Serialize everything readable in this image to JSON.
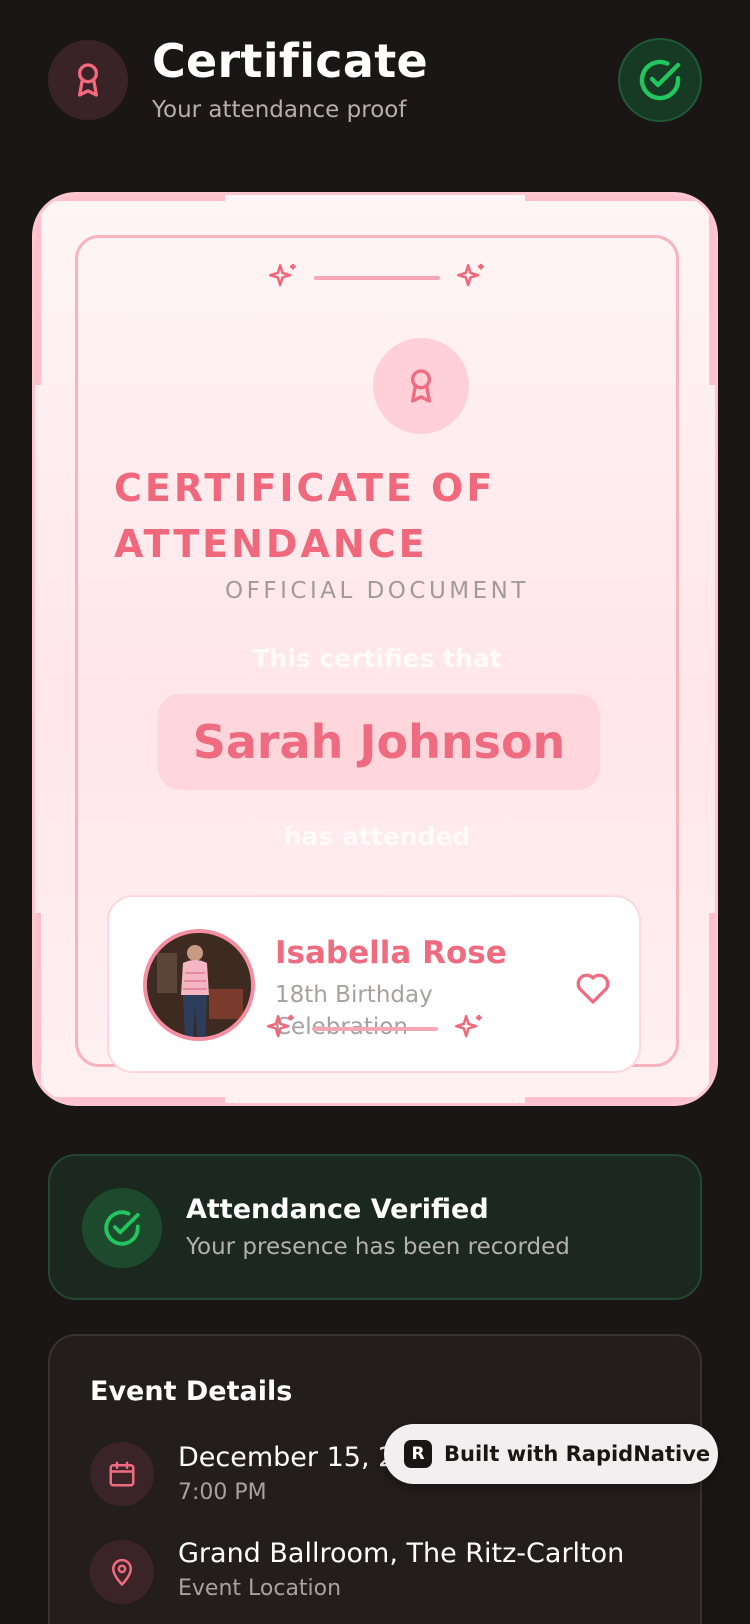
{
  "header": {
    "title": "Certificate",
    "subtitle": "Your attendance proof",
    "icon": "award-icon",
    "status_icon": "check-circle-icon"
  },
  "certificate": {
    "heading": "CERTIFICATE OF ATTENDANCE",
    "official": "OFFICIAL DOCUMENT",
    "certifies": "This certifies that",
    "recipient": "Sarah Johnson",
    "has_attended": "has attended",
    "event": {
      "host": "Isabella Rose",
      "name": "18th Birthday Celebration",
      "avatar": "host-photo",
      "favorite_icon": "heart-icon"
    }
  },
  "verified": {
    "title": "Attendance Verified",
    "subtitle": "Your presence has been recorded"
  },
  "details": {
    "title": "Event Details",
    "date": "December 15, 2",
    "time": "7:00 PM",
    "location": "Grand Ballroom, The Ritz-Carlton",
    "location_label": "Event Location"
  },
  "badge": {
    "text": "Built with RapidNative",
    "logo": "R"
  },
  "colors": {
    "accent": "#ef6c80",
    "success": "#22c55e",
    "background": "#1b1616"
  }
}
